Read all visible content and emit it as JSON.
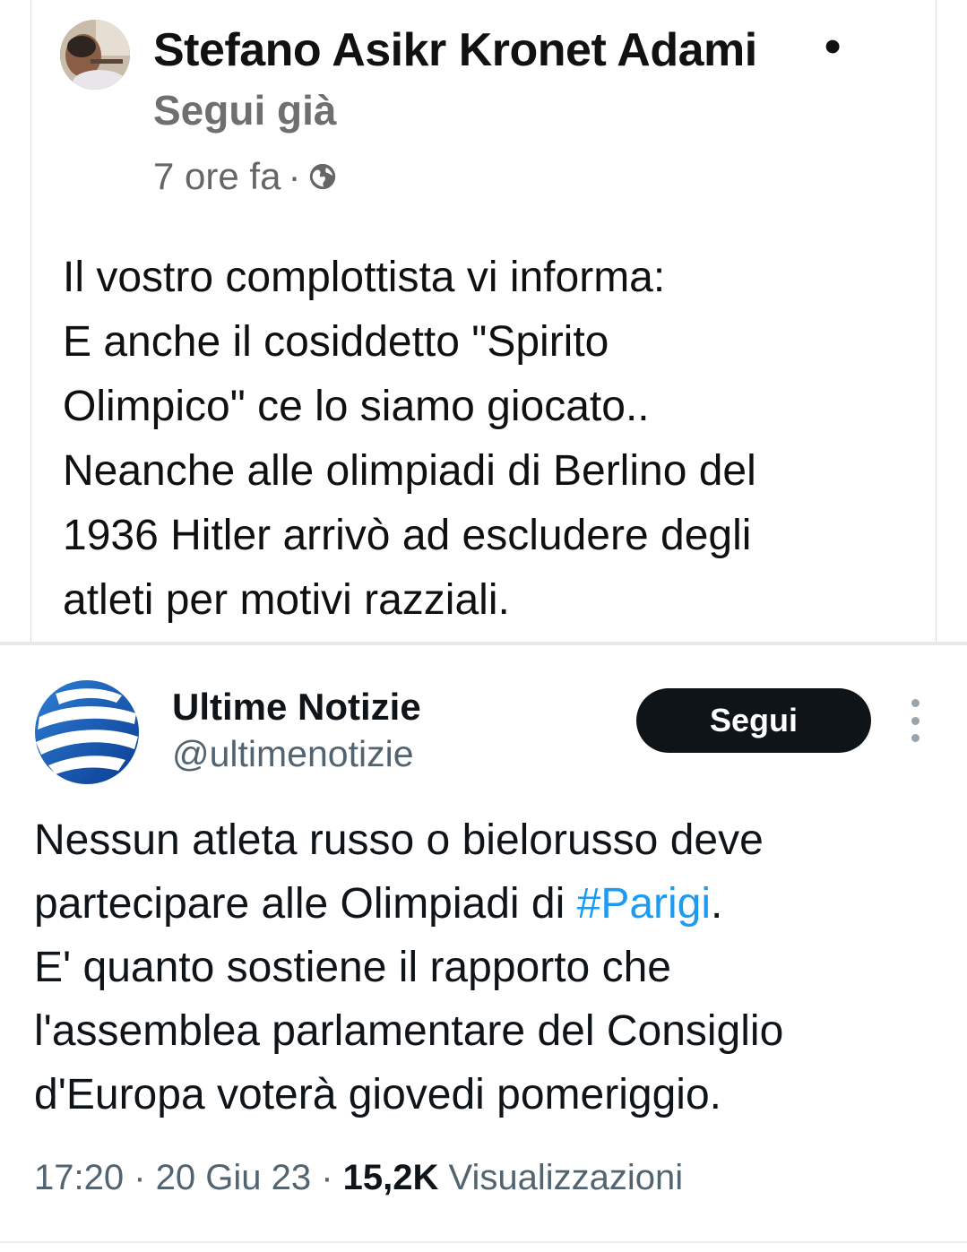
{
  "facebook_post": {
    "author_name": "Stefano Asikr Kronet Adami",
    "separator_dot": "•",
    "follow_status": "Segui già",
    "timestamp": "7 ore fa",
    "meta_separator": "·",
    "privacy_icon": "globe-icon",
    "text_lines": [
      "Il vostro complottista vi informa:",
      "E anche il cosiddetto \"Spirito",
      "Olimpico\" ce lo siamo giocato..",
      "Neanche alle olimpiadi di Berlino del",
      "1936 Hitler arrivò ad escludere degli",
      "atleti per motivi razziali."
    ]
  },
  "tweet": {
    "account_name": "Ultime Notizie",
    "handle": "@ultimenotizie",
    "follow_label": "Segui",
    "more_icon": "more-vertical-icon",
    "text": {
      "line1": "Nessun atleta russo o bielorusso deve",
      "line2_before": "partecipare alle Olimpiadi di ",
      "hashtag": "#Parigi",
      "line2_after": ".",
      "line3": "E' quanto sostiene il rapporto che",
      "line4": "l'assemblea parlamentare del Consiglio",
      "line5": "d'Europa voterà giovedi pomeriggio."
    },
    "time": "17:20",
    "date": "20 Giu 23",
    "sep": " · ",
    "views_count": "15,2K",
    "views_label": " Visualizzazioni",
    "hashtag_color": "#1d9bf0"
  }
}
